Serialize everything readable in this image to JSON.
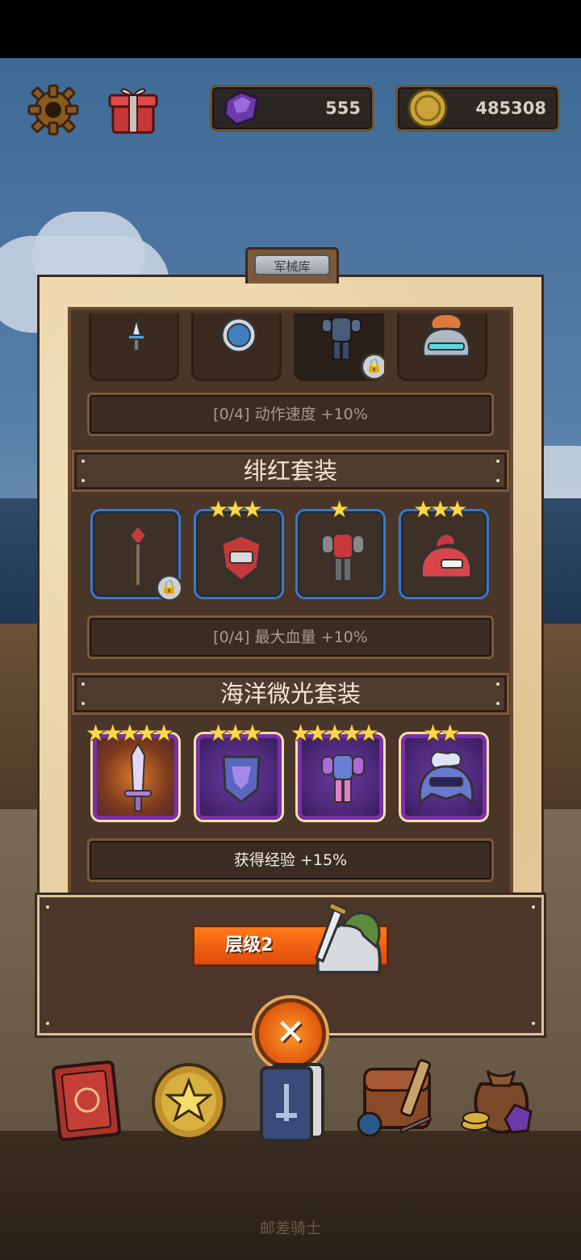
{
  "hud": {
    "gems": "555",
    "coins": "485308",
    "icons": [
      "gear-icon",
      "gift-icon",
      "gem-icon",
      "coin-icon"
    ]
  },
  "panel": {
    "tab_label": "军械库",
    "top_set": {
      "bonus": "[0/4] 动作速度 +10%",
      "items": [
        {
          "icon": "dagger-icon",
          "locked": false
        },
        {
          "icon": "ring-icon",
          "locked": false
        },
        {
          "icon": "blue-armor-icon",
          "locked": true
        },
        {
          "icon": "helmet-icon",
          "locked": false
        }
      ]
    },
    "crimson_set": {
      "title": "绯红套装",
      "bonus": "[0/4] 最大血量 +10%",
      "items": [
        {
          "icon": "spear-icon",
          "stars": 0,
          "locked": true
        },
        {
          "icon": "shield-icon",
          "stars": 3,
          "locked": false
        },
        {
          "icon": "armor-icon",
          "stars": 1,
          "locked": false
        },
        {
          "icon": "helmet-icon",
          "stars": 3,
          "locked": false
        }
      ]
    },
    "ocean_set": {
      "title": "海洋微光套装",
      "bonus": "获得经验 +15%",
      "items": [
        {
          "icon": "sword-icon",
          "stars": 5
        },
        {
          "icon": "shield-icon",
          "stars": 3
        },
        {
          "icon": "armor-icon",
          "stars": 5
        },
        {
          "icon": "helmet-icon",
          "stars": 2
        }
      ]
    }
  },
  "footer": {
    "tier_label": "层级2",
    "close_icon": "close-icon"
  },
  "nav": [
    "book-icon",
    "star-coin-icon",
    "card-deck-icon",
    "backpack-icon",
    "loot-bag-icon"
  ],
  "app_title": "邮差骑士",
  "colors": {
    "accent": "#e14a0a",
    "set_blue": "#3a78c8",
    "set_purple": "#7a2fa8",
    "star": "#ffd84a"
  }
}
